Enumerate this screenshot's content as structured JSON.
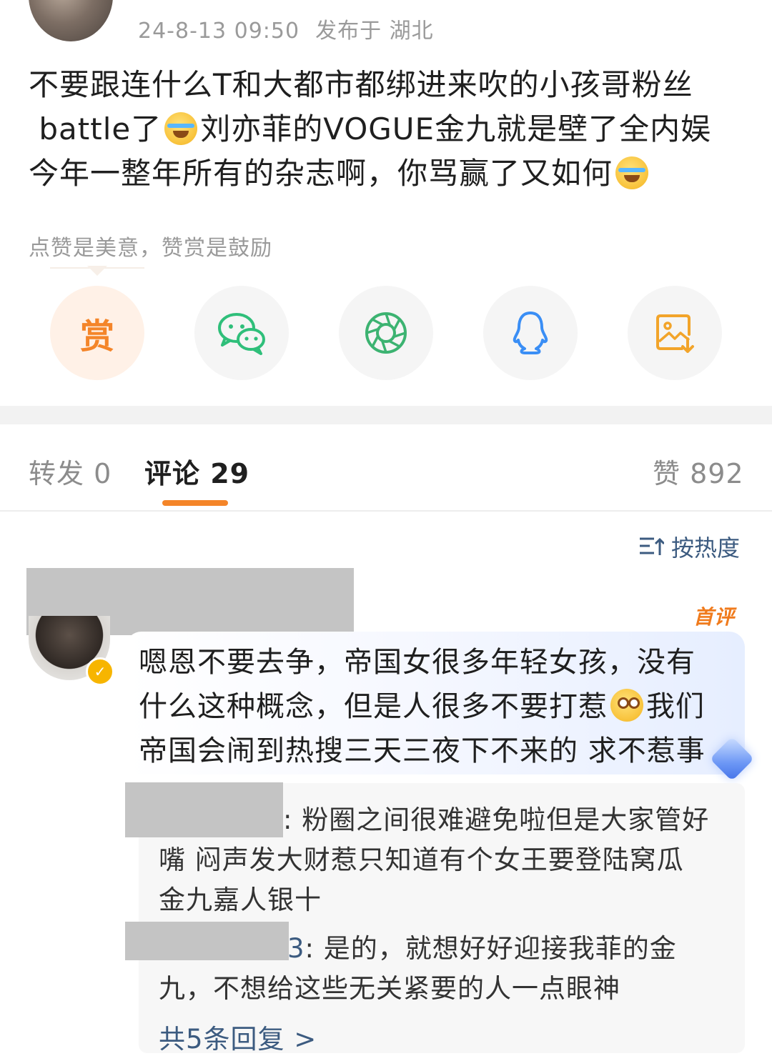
{
  "post": {
    "meta_time": "24-8-13 09:50",
    "meta_location": "发布于 湖北",
    "lines": [
      "不要跟连什么T和大都市都绑进来吹的小孩哥粉丝",
      "battle了",
      "刘亦菲的VOGUE金九就是壁了全内娱",
      "今年一整年所有的杂志啊，你骂赢了又如何"
    ],
    "emojis": [
      "laugh-cry-emoji",
      "laugh-cry-emoji"
    ]
  },
  "reward_hint": "点赞是美意，赞赏是鼓励",
  "share_actions": [
    {
      "name": "reward",
      "label": "赏",
      "icon": "reward-icon"
    },
    {
      "name": "wechat",
      "icon": "wechat-icon"
    },
    {
      "name": "moments",
      "icon": "moments-icon"
    },
    {
      "name": "qq",
      "icon": "qq-icon"
    },
    {
      "name": "save-image",
      "icon": "save-image-icon"
    }
  ],
  "tabs": {
    "repost": "转发 0",
    "comments": "评论 29",
    "likes": "赞 892"
  },
  "sort_label": "按热度",
  "comment": {
    "badge": "首评",
    "lines": [
      "嗯恩不要去争，帝国女很多年轻女孩，没有",
      "什么这种概念，但是人很多不要打惹",
      "我们",
      "帝国会闹到热搜三天三夜下不来的 求不惹事"
    ],
    "emoji": "eye-roll-emoji"
  },
  "replies": [
    {
      "line1": ": 粉圈之间很难避免啦但是大家管好",
      "line2": "嘴 闷声发大财惹只知道有个女王要登陆窝瓜",
      "line3": "金九嘉人银十"
    },
    {
      "user_tail": "3",
      "line1": ": 是的，就想好好迎接我菲的金",
      "line2": "九，不想给这些无关紧要的人一点眼神"
    }
  ],
  "more_replies": "共5条回复 >",
  "colors": {
    "accent_orange": "#f48529",
    "link_blue": "#3c5b80",
    "meta_gray": "#9a9a9a"
  }
}
